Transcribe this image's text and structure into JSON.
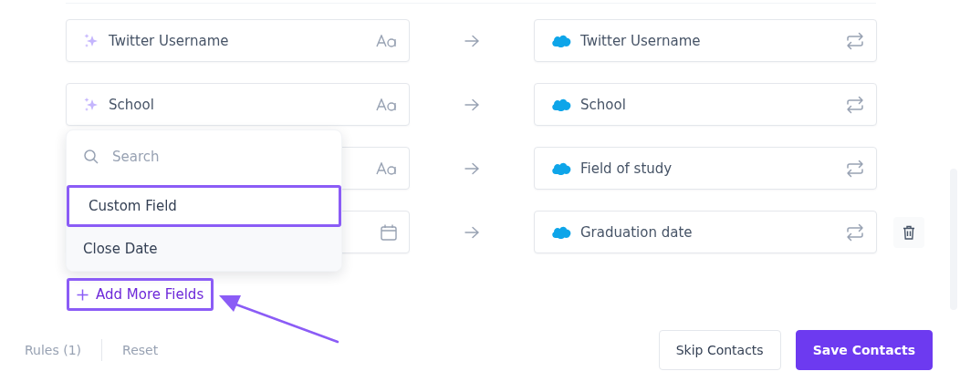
{
  "mappings": [
    {
      "source": {
        "label": "Twitter Username",
        "kind": "text"
      },
      "target": {
        "label": "Twitter Username"
      },
      "deletable": false
    },
    {
      "source": {
        "label": "School",
        "kind": "text"
      },
      "target": {
        "label": "School"
      },
      "deletable": false
    },
    {
      "source": {
        "kind": "text"
      },
      "target": {
        "label": "Field of study"
      },
      "deletable": false
    },
    {
      "source": {
        "kind": "date"
      },
      "target": {
        "label": "Graduation date"
      },
      "deletable": true
    }
  ],
  "dropdown": {
    "search": {
      "placeholder": "Search"
    },
    "options": [
      {
        "label": "Custom Field",
        "selected": true
      },
      {
        "label": "Close Date",
        "selected": false
      }
    ]
  },
  "add_button": {
    "label": "Add More Fields",
    "highlighted": true
  },
  "footer": {
    "links": [
      "Rules (1)",
      "Reset"
    ],
    "buttons": [
      {
        "label": "Skip Contacts",
        "kind": "secondary"
      },
      {
        "label": "Save Contacts",
        "kind": "primary"
      }
    ]
  }
}
